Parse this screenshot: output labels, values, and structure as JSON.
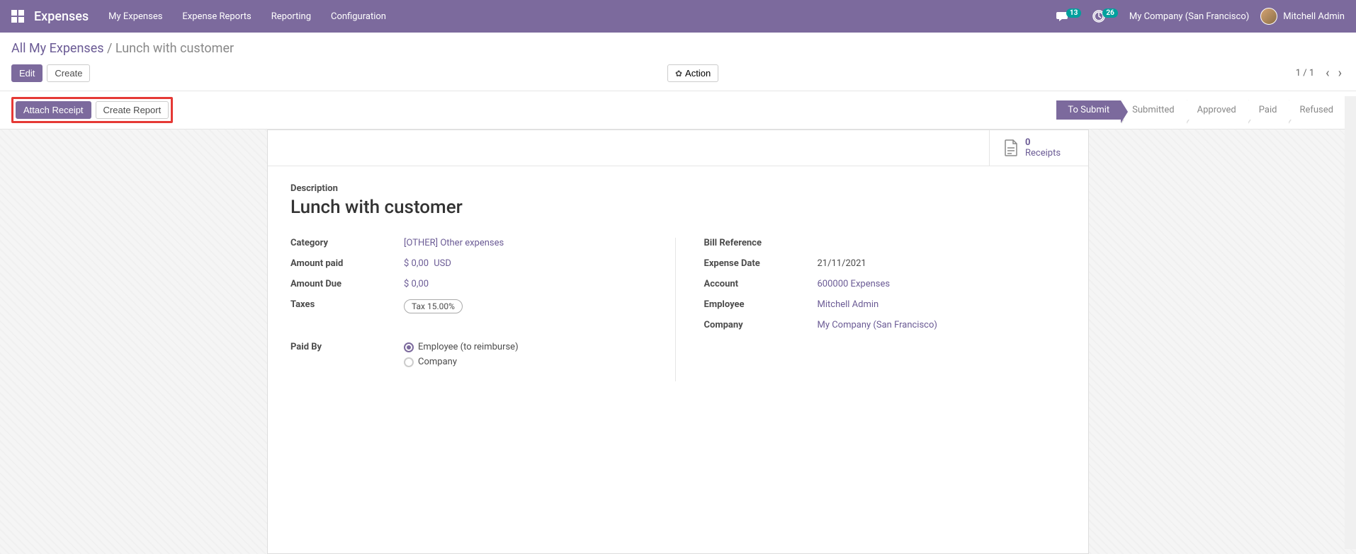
{
  "navbar": {
    "app_name": "Expenses",
    "menu": [
      "My Expenses",
      "Expense Reports",
      "Reporting",
      "Configuration"
    ],
    "chat_count": "13",
    "activity_count": "26",
    "company": "My Company (San Francisco)",
    "user": "Mitchell Admin"
  },
  "breadcrumb": {
    "root": "All My Expenses",
    "sep": "/",
    "current": "Lunch with customer"
  },
  "buttons": {
    "edit": "Edit",
    "create": "Create",
    "action": "Action",
    "attach_receipt": "Attach Receipt",
    "create_report": "Create Report"
  },
  "pager": {
    "text": "1 / 1"
  },
  "status_steps": [
    "To Submit",
    "Submitted",
    "Approved",
    "Paid",
    "Refused"
  ],
  "stat": {
    "count": "0",
    "label": "Receipts"
  },
  "form": {
    "desc_label": "Description",
    "title": "Lunch with customer",
    "left": {
      "category_label": "Category",
      "category_value": "[OTHER] Other expenses",
      "amount_paid_label": "Amount paid",
      "amount_paid_value": "$ 0,00",
      "amount_paid_currency": "USD",
      "amount_due_label": "Amount Due",
      "amount_due_value": "$ 0,00",
      "taxes_label": "Taxes",
      "taxes_value": "Tax 15.00%",
      "paid_by_label": "Paid By",
      "paid_by_opt1": "Employee (to reimburse)",
      "paid_by_opt2": "Company"
    },
    "right": {
      "bill_ref_label": "Bill Reference",
      "bill_ref_value": "",
      "expense_date_label": "Expense Date",
      "expense_date_value": "21/11/2021",
      "account_label": "Account",
      "account_value": "600000 Expenses",
      "employee_label": "Employee",
      "employee_value": "Mitchell Admin",
      "company_label": "Company",
      "company_value": "My Company (San Francisco)"
    }
  }
}
